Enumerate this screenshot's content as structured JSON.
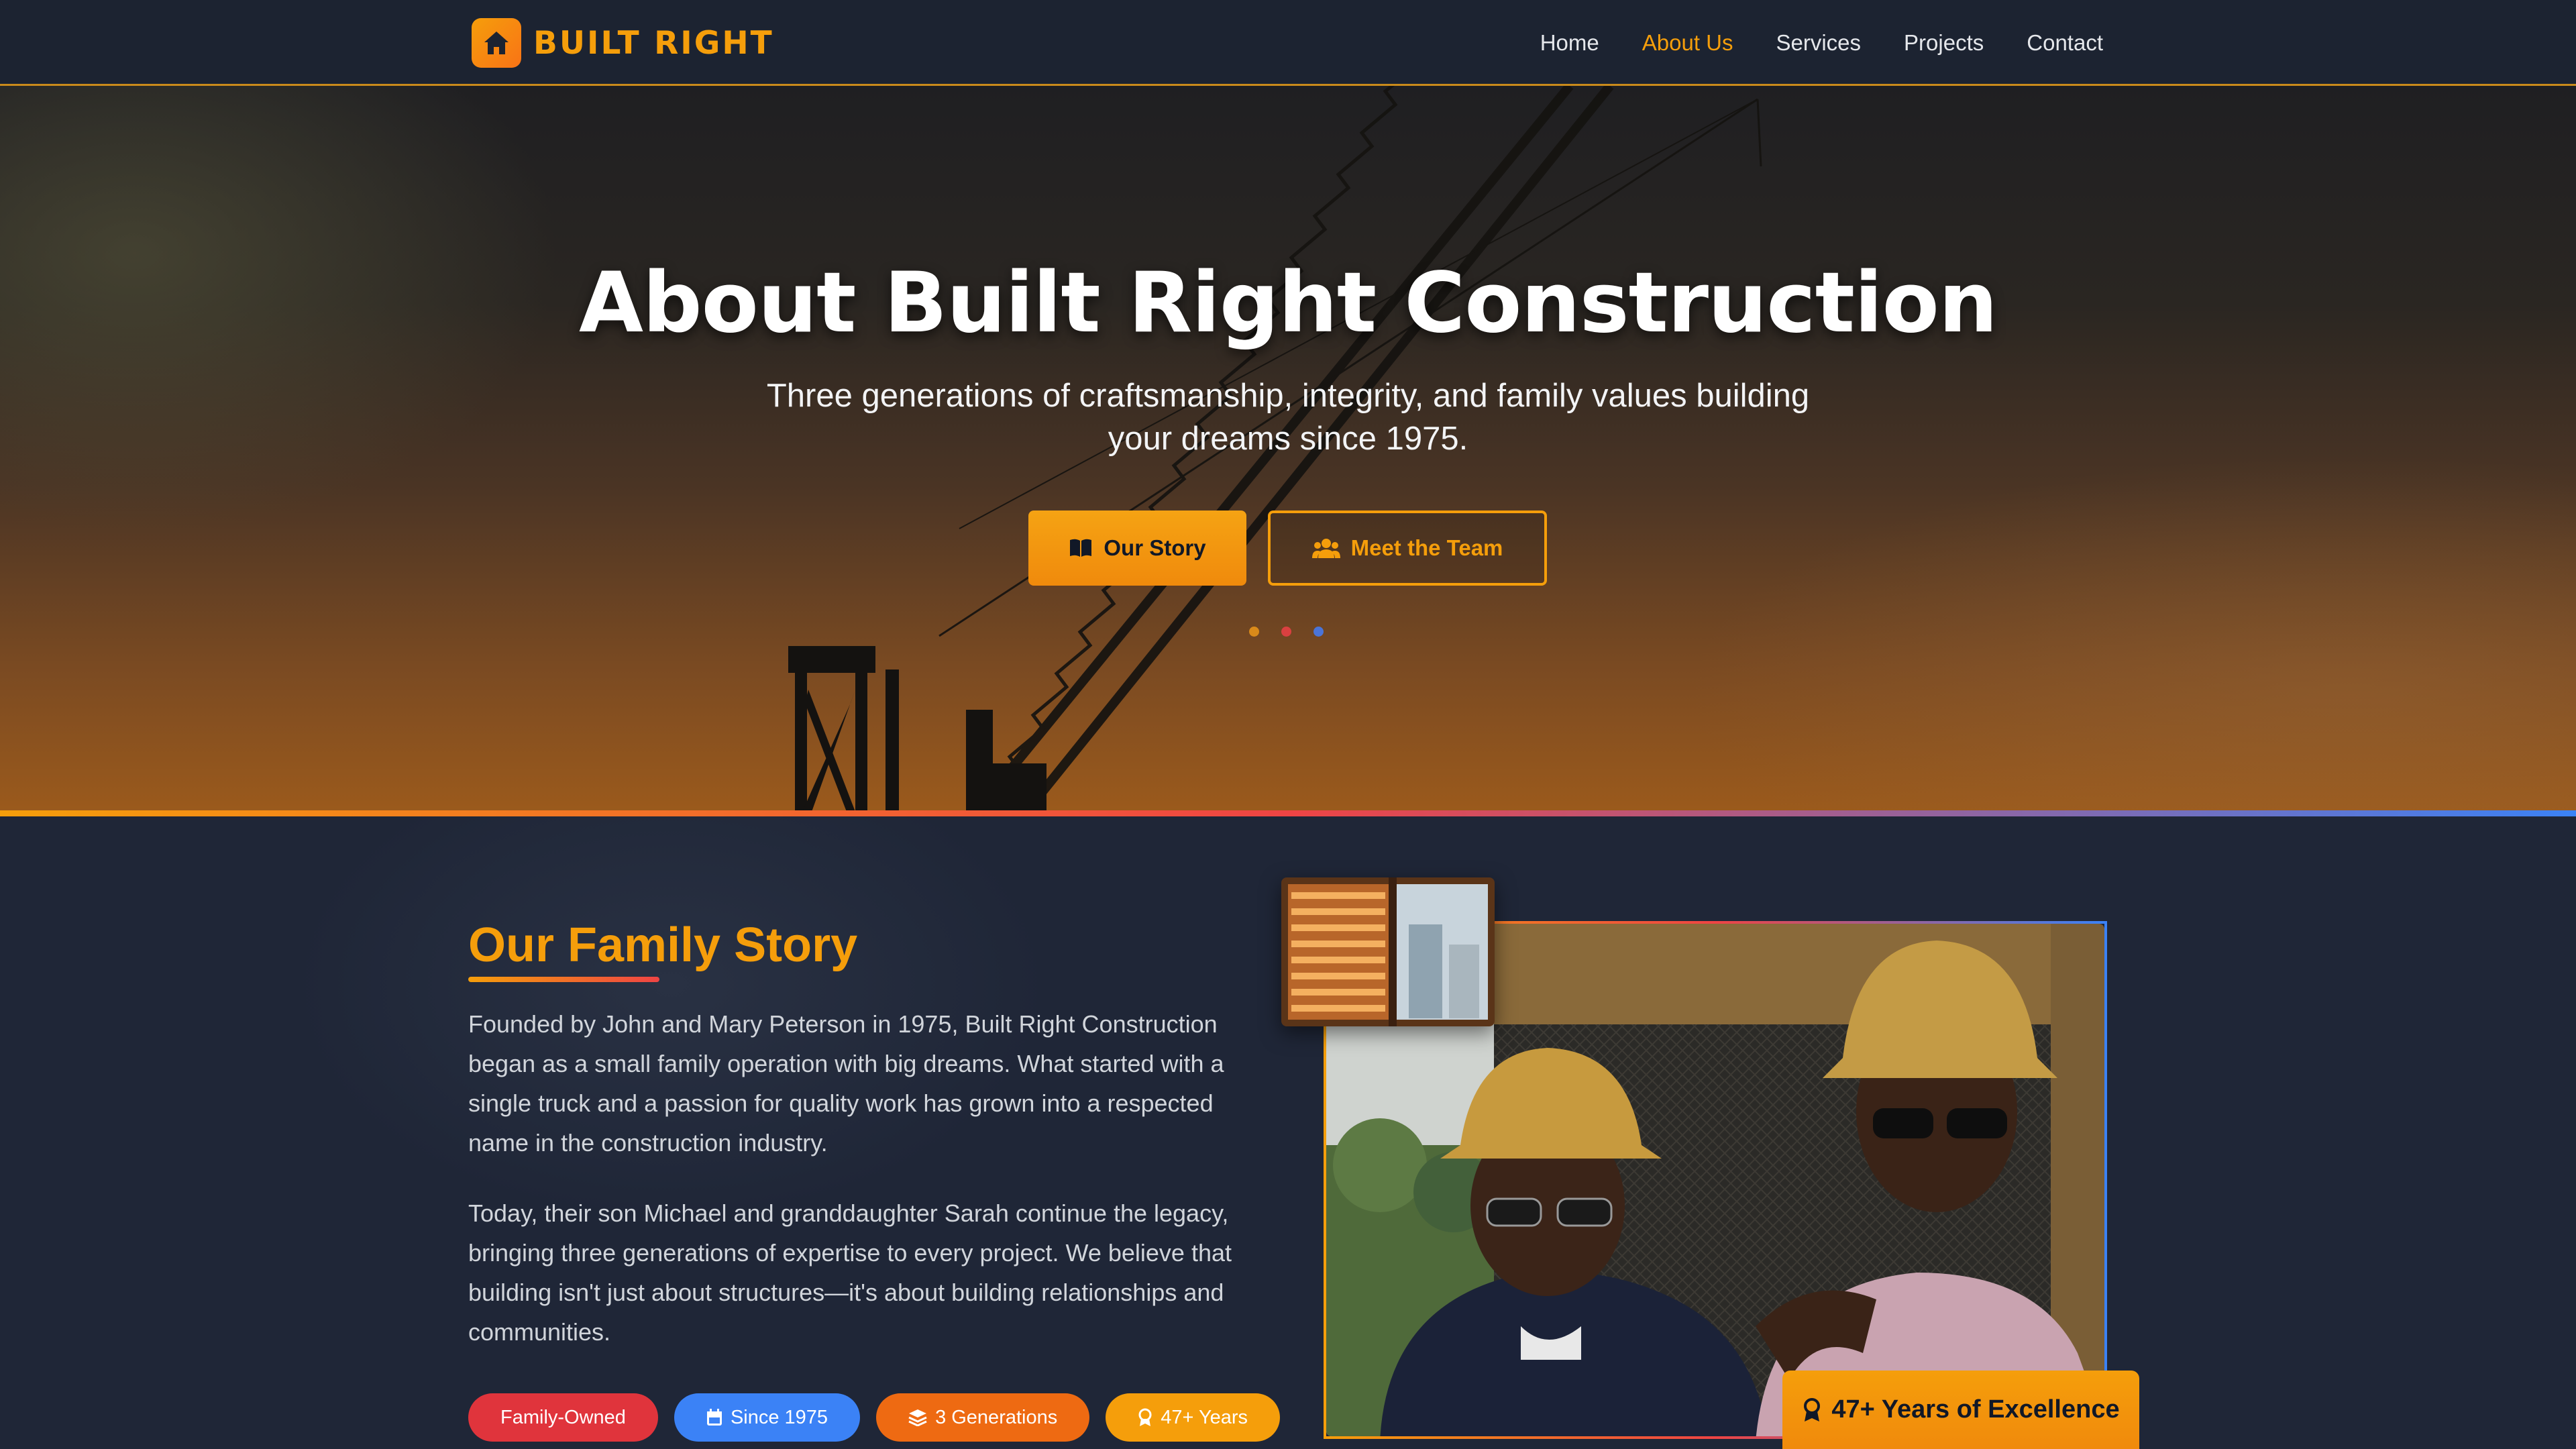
{
  "nav": {
    "brand": "BUILT RIGHT",
    "links": [
      {
        "label": "Home",
        "active": false
      },
      {
        "label": "About Us",
        "active": true
      },
      {
        "label": "Services",
        "active": false
      },
      {
        "label": "Projects",
        "active": false
      },
      {
        "label": "Contact",
        "active": false
      }
    ]
  },
  "hero": {
    "title": "About Built Right Construction",
    "subtitle": "Three generations of craftsmanship, integrity, and family values building your dreams since 1975.",
    "primary_button": "Our Story",
    "secondary_button": "Meet the Team",
    "dot_colors": [
      "#d98a1a",
      "#d94040",
      "#4a74d8"
    ]
  },
  "story": {
    "title": "Our Family Story",
    "paragraph1": "Founded by John and Mary Peterson in 1975, Built Right Construction began as a small family operation with big dreams. What started with a single truck and a passion for quality work has grown into a respected name in the construction industry.",
    "paragraph2": "Today, their son Michael and granddaughter Sarah continue the legacy, bringing three generations of expertise to every project. We believe that building isn't just about structures—it's about building relationships and communities.",
    "badges": [
      {
        "label": "Family-Owned",
        "color": "#e0343c",
        "icon": ""
      },
      {
        "label": "Since 1975",
        "color": "#3b82f6",
        "icon": "calendar-icon"
      },
      {
        "label": "3 Generations",
        "color": "#ee6a12",
        "icon": "layers-icon"
      },
      {
        "label": "47+ Years",
        "color": "#f59e0b",
        "icon": "award-icon"
      }
    ],
    "excellence_label": "47+ Years of Excellence"
  },
  "colors": {
    "accent": "#f59e0b",
    "background": "#1f2637",
    "nav_background": "#1c2331"
  }
}
